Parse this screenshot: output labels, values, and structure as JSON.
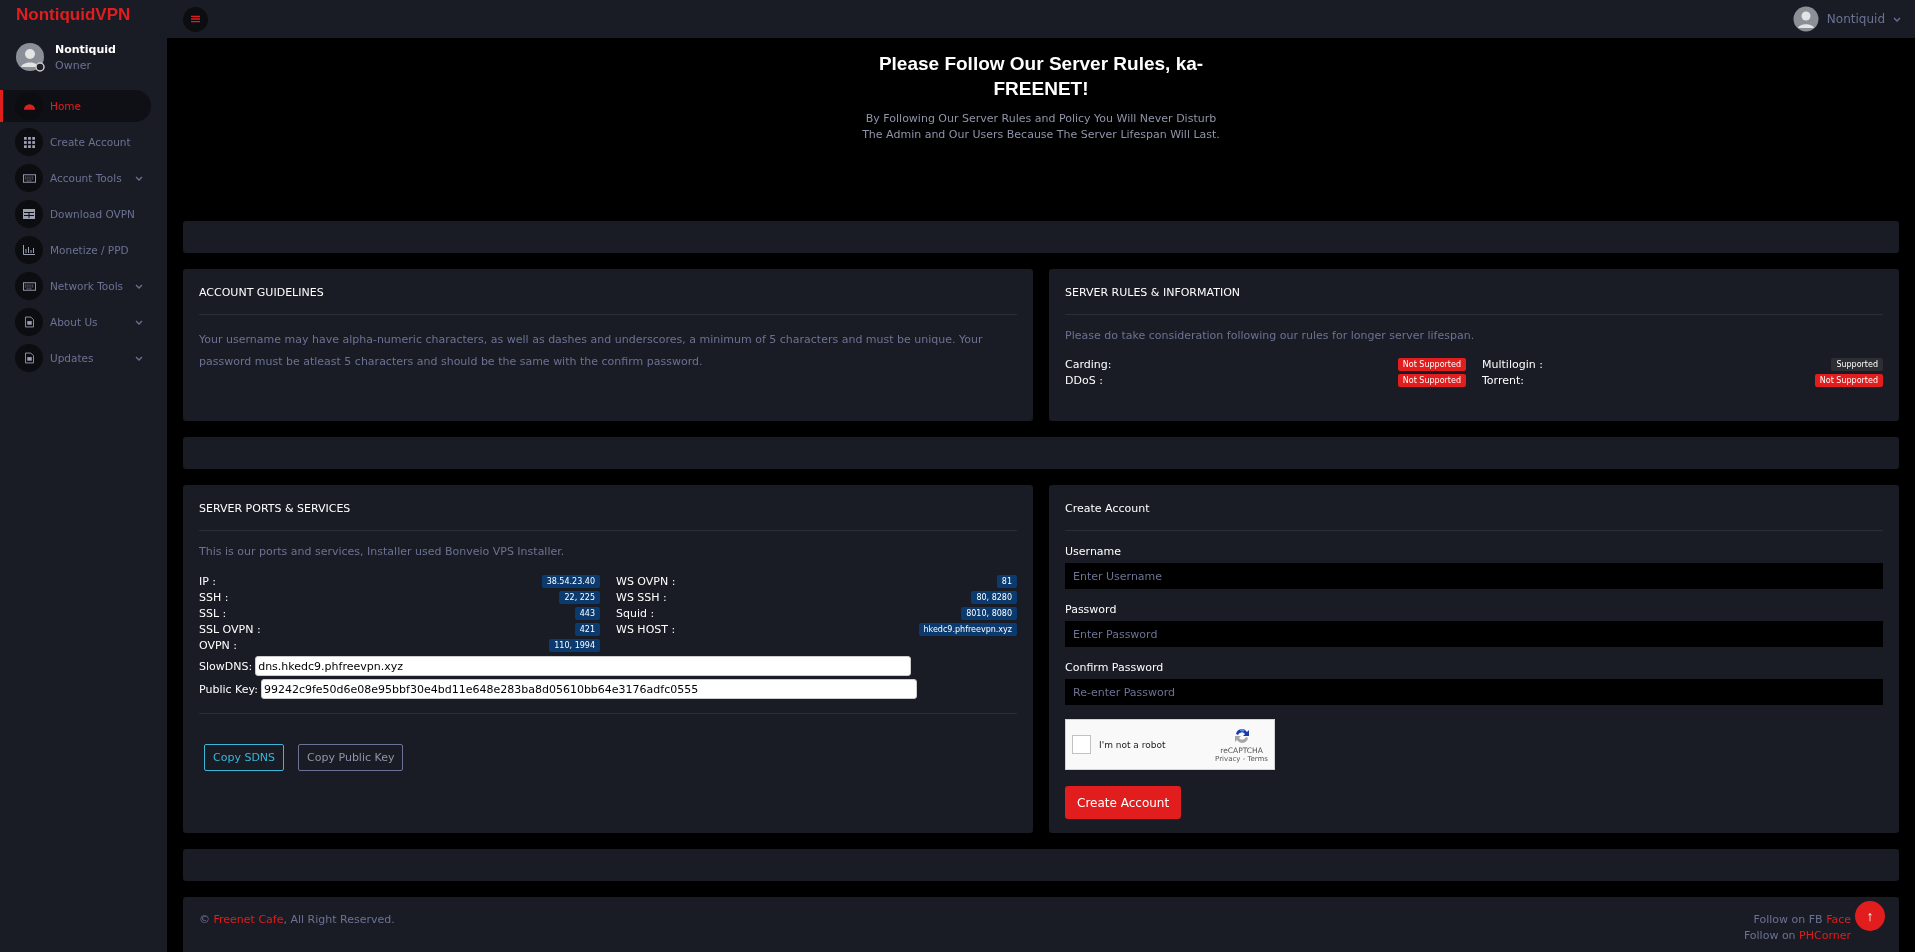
{
  "brand": "NontiquidVPN",
  "user": {
    "name": "Nontiquid",
    "role": "Owner"
  },
  "header": {
    "user_name": "Nontiquid"
  },
  "sidebar": {
    "items": [
      {
        "label": "Home",
        "selected": true,
        "has_caret": false
      },
      {
        "label": "Create Account",
        "selected": false,
        "has_caret": false
      },
      {
        "label": "Account Tools",
        "selected": false,
        "has_caret": true
      },
      {
        "label": "Download OVPN",
        "selected": false,
        "has_caret": false
      },
      {
        "label": "Monetize / PPD",
        "selected": false,
        "has_caret": false
      },
      {
        "label": "Network Tools",
        "selected": false,
        "has_caret": true
      },
      {
        "label": "About Us",
        "selected": false,
        "has_caret": true
      },
      {
        "label": "Updates",
        "selected": false,
        "has_caret": true
      }
    ]
  },
  "hero": {
    "title": "Please Follow Our Server Rules, ka-FREENET!",
    "subtitle": "By Following Our Server Rules and Policy You Will Never Disturb The Admin and Our Users Because The Server Lifespan Will Last."
  },
  "guidelines": {
    "title": "ACCOUNT GUIDELINES",
    "text": "Your username may have alpha-numeric characters, as well as dashes and underscores, a minimum of 5 characters and must be unique. Your password must be atleast 5 characters and should be the same with the confirm password."
  },
  "rules": {
    "title": "SERVER RULES & INFORMATION",
    "text": "Please do take consideration following our rules for longer server lifespan.",
    "items": [
      {
        "label": "Carding:",
        "status": "Not Supported",
        "supported": false
      },
      {
        "label": "Multilogin :",
        "status": "Supported",
        "supported": true
      },
      {
        "label": "DDoS :",
        "status": "Not Supported",
        "supported": false
      },
      {
        "label": "Torrent:",
        "status": "Not Supported",
        "supported": false
      }
    ]
  },
  "ports": {
    "title": "SERVER PORTS & SERVICES",
    "text": "This is our ports and services, Installer used Bonveio VPS Installer.",
    "left": [
      {
        "label": "IP :",
        "value": "38.54.23.40"
      },
      {
        "label": "SSH :",
        "value": "22, 225"
      },
      {
        "label": "SSL :",
        "value": "443"
      },
      {
        "label": "SSL OVPN :",
        "value": "421"
      },
      {
        "label": "OVPN :",
        "value": "110, 1994"
      }
    ],
    "right": [
      {
        "label": "WS OVPN :",
        "value": "81"
      },
      {
        "label": "WS SSH :",
        "value": "80, 8280"
      },
      {
        "label": "Squid :",
        "value": "8010, 8080"
      },
      {
        "label": "WS HOST :",
        "value": "hkedc9.phfreevpn.xyz"
      }
    ],
    "fields": [
      {
        "label": "SlowDNS:",
        "value": "dns.hkedc9.phfreevpn.xyz"
      },
      {
        "label": "Public Key:",
        "value": "99242c9fe50d6e08e95bbf30e4bd11e648e283ba8d05610bb64e3176adfc0555"
      }
    ],
    "buttons": [
      {
        "label": "Copy SDNS",
        "selected": true
      },
      {
        "label": "Copy Public Key",
        "selected": false
      }
    ]
  },
  "create": {
    "title": "Create Account",
    "fields": [
      {
        "label": "Username",
        "placeholder": "Enter Username"
      },
      {
        "label": "Password",
        "placeholder": "Enter Password"
      },
      {
        "label": "Confirm Password",
        "placeholder": "Re-enter Password"
      }
    ],
    "captcha": {
      "label": "I'm not a robot",
      "brand": "reCAPTCHA",
      "links": "Privacy - Terms",
      "checked": false
    },
    "button": "Create Account"
  },
  "footer": {
    "copyright_prefix": "©",
    "link": "Freenet Cafe",
    "copyright_suffix": ", All Right Reserved.",
    "follow": [
      {
        "text": "Follow on FB",
        "link": "Face"
      },
      {
        "text": "Follow on",
        "link": "PHCorner"
      }
    ],
    "scroll_top": "↑"
  }
}
